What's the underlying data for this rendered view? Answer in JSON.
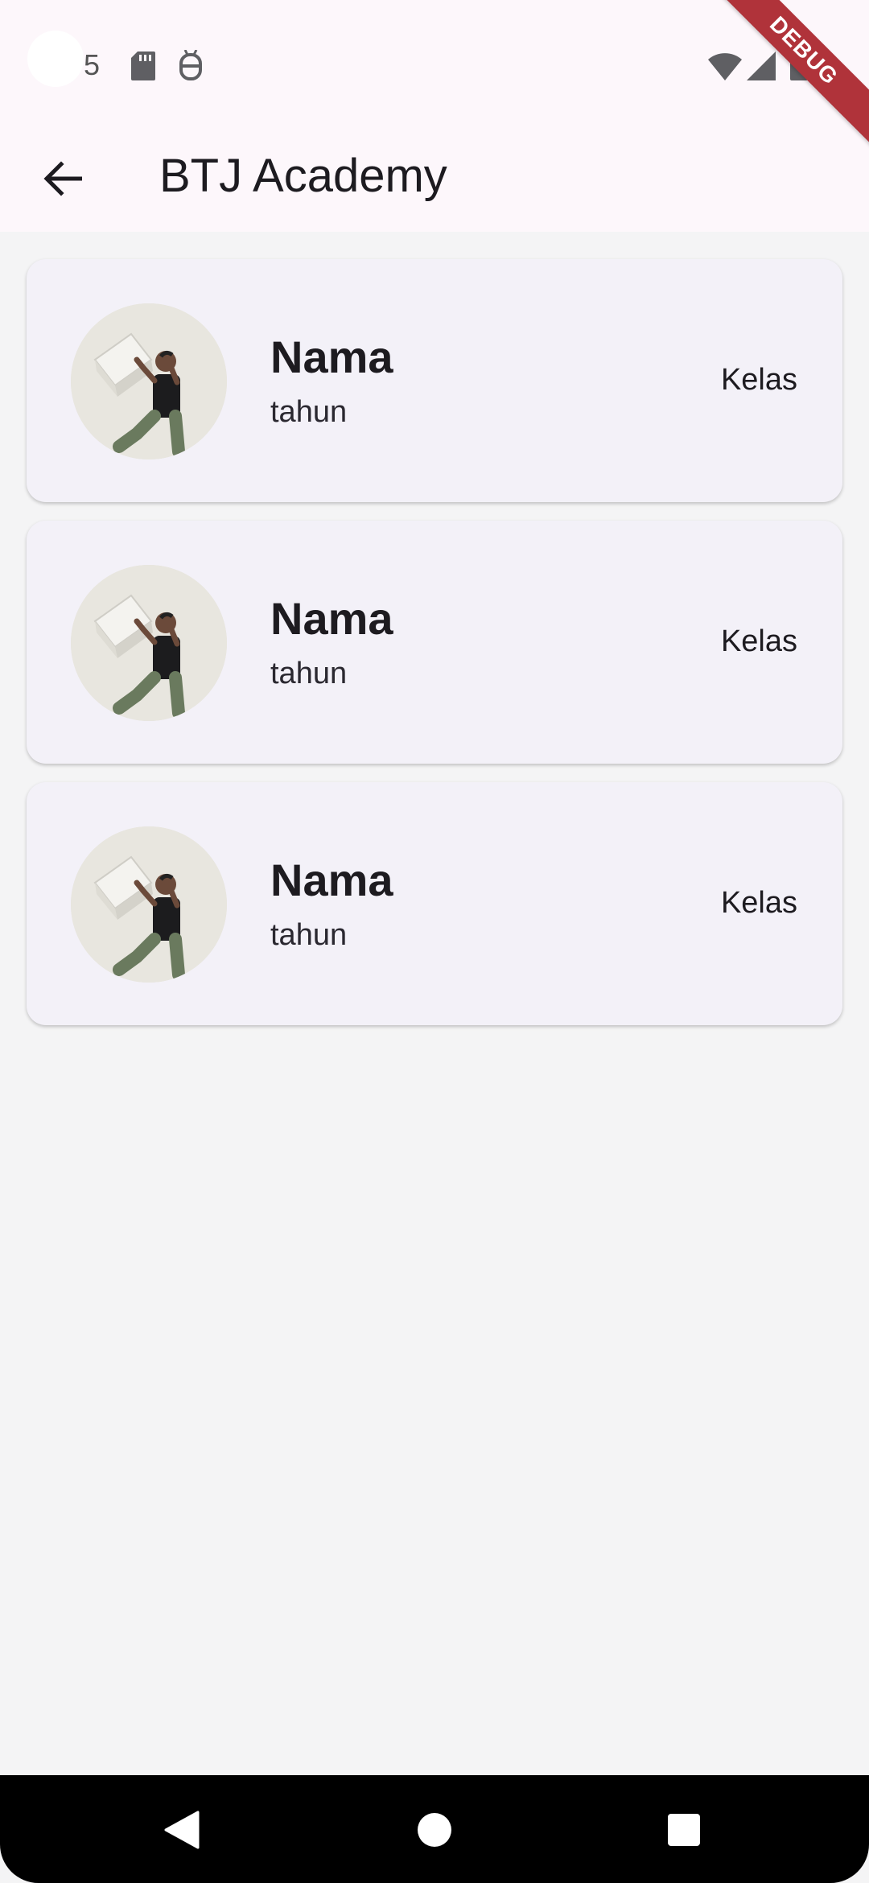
{
  "status_bar": {
    "notification_count": "5",
    "icons": [
      "sd-card-icon",
      "android-bot-icon",
      "wifi-icon",
      "signal-icon",
      "battery-icon"
    ]
  },
  "debug_banner": {
    "label": "DEBUG",
    "color": "#b0333a"
  },
  "app_bar": {
    "title": "BTJ Academy",
    "back_icon": "arrow-left-icon",
    "background": "#fdf7fb"
  },
  "students": [
    {
      "name": "Nama",
      "year": "tahun",
      "class": "Kelas",
      "avatar": "person-lifting-box-photo"
    },
    {
      "name": "Nama",
      "year": "tahun",
      "class": "Kelas",
      "avatar": "person-lifting-box-photo"
    },
    {
      "name": "Nama",
      "year": "tahun",
      "class": "Kelas",
      "avatar": "person-lifting-box-photo"
    }
  ],
  "nav_bar": {
    "buttons": [
      "back-triangle-icon",
      "home-circle-icon",
      "recents-square-icon"
    ]
  },
  "colors": {
    "page_background": "#f4f4f5",
    "card_background": "#f3f1f8",
    "text_primary": "#1d1b20"
  }
}
